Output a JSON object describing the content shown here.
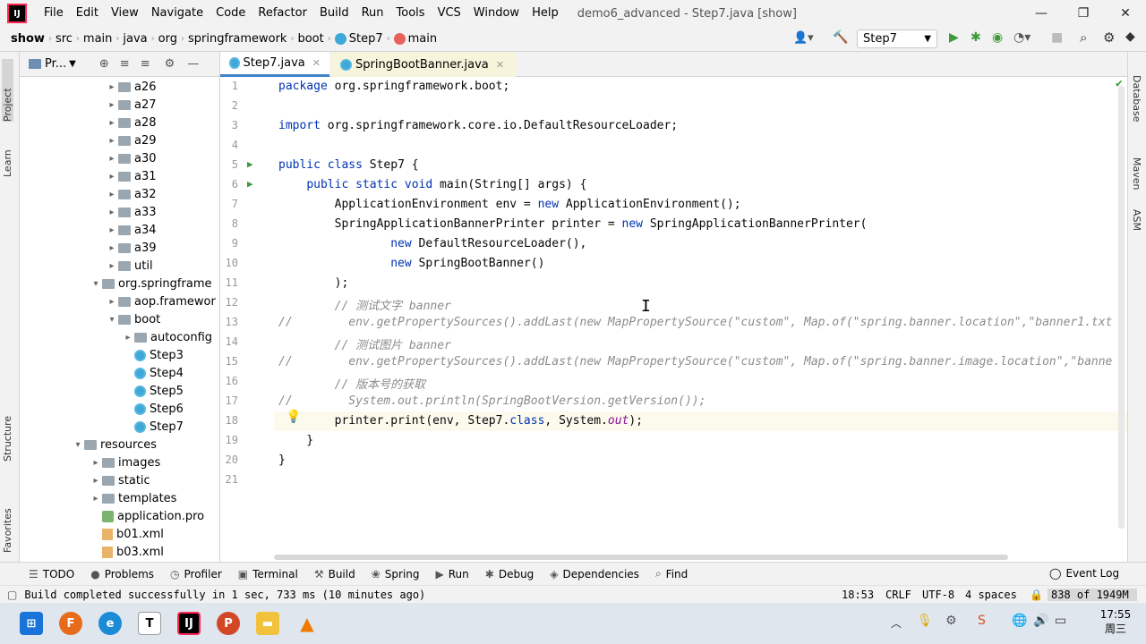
{
  "window": {
    "title": "demo6_advanced - Step7.java [show]"
  },
  "menu": [
    "File",
    "Edit",
    "View",
    "Navigate",
    "Code",
    "Refactor",
    "Build",
    "Run",
    "Tools",
    "VCS",
    "Window",
    "Help"
  ],
  "breadcrumb": [
    "show",
    "src",
    "main",
    "java",
    "org",
    "springframework",
    "boot",
    "Step7",
    "main"
  ],
  "run_config": "Step7",
  "project_panel": {
    "title": "Pr...",
    "tree": [
      {
        "label": "a26",
        "type": "folder",
        "level": 1
      },
      {
        "label": "a27",
        "type": "folder",
        "level": 1
      },
      {
        "label": "a28",
        "type": "folder",
        "level": 1
      },
      {
        "label": "a29",
        "type": "folder",
        "level": 1
      },
      {
        "label": "a30",
        "type": "folder",
        "level": 1
      },
      {
        "label": "a31",
        "type": "folder",
        "level": 1
      },
      {
        "label": "a32",
        "type": "folder",
        "level": 1
      },
      {
        "label": "a33",
        "type": "folder",
        "level": 1
      },
      {
        "label": "a34",
        "type": "folder",
        "level": 1
      },
      {
        "label": "a39",
        "type": "folder",
        "level": 1
      },
      {
        "label": "util",
        "type": "folder",
        "level": 1
      },
      {
        "label": "org.springframe",
        "type": "folder",
        "level": 0
      },
      {
        "label": "aop.framewor",
        "type": "folder",
        "level": 1
      },
      {
        "label": "boot",
        "type": "folder",
        "level": 1
      },
      {
        "label": "autoconfig",
        "type": "folder",
        "level": 2
      },
      {
        "label": "Step3",
        "type": "class",
        "level": 2
      },
      {
        "label": "Step4",
        "type": "class",
        "level": 2
      },
      {
        "label": "Step5",
        "type": "class",
        "level": 2
      },
      {
        "label": "Step6",
        "type": "class",
        "level": 2
      },
      {
        "label": "Step7",
        "type": "class",
        "level": 2
      },
      {
        "label": "resources",
        "type": "folder",
        "level": -1
      },
      {
        "label": "images",
        "type": "folder",
        "level": 0
      },
      {
        "label": "static",
        "type": "folder",
        "level": 0
      },
      {
        "label": "templates",
        "type": "folder",
        "level": 0
      },
      {
        "label": "application.pro",
        "type": "props",
        "level": 0
      },
      {
        "label": "b01.xml",
        "type": "xml",
        "level": 0
      },
      {
        "label": "b03.xml",
        "type": "xml",
        "level": 0
      }
    ]
  },
  "tabs": [
    {
      "label": "Step7.java",
      "active": true
    },
    {
      "label": "SpringBootBanner.java",
      "active": false
    }
  ],
  "code_lines": [
    {
      "n": "1",
      "t": "package org.springframework.boot;"
    },
    {
      "n": "2",
      "t": ""
    },
    {
      "n": "3",
      "t": "import org.springframework.core.io.DefaultResourceLoader;"
    },
    {
      "n": "4",
      "t": ""
    },
    {
      "n": "5",
      "t": "public class Step7 {"
    },
    {
      "n": "6",
      "t": "    public static void main(String[] args) {"
    },
    {
      "n": "7",
      "t": "        ApplicationEnvironment env = new ApplicationEnvironment();"
    },
    {
      "n": "8",
      "t": "        SpringApplicationBannerPrinter printer = new SpringApplicationBannerPrinter("
    },
    {
      "n": "9",
      "t": "                new DefaultResourceLoader(),"
    },
    {
      "n": "10",
      "t": "                new SpringBootBanner()"
    },
    {
      "n": "11",
      "t": "        );"
    },
    {
      "n": "12",
      "t": "        // 测试文字 banner"
    },
    {
      "n": "13",
      "t": "//        env.getPropertySources().addLast(new MapPropertySource(\"custom\", Map.of(\"spring.banner.location\",\"banner1.txt"
    },
    {
      "n": "14",
      "t": "        // 测试图片 banner"
    },
    {
      "n": "15",
      "t": "//        env.getPropertySources().addLast(new MapPropertySource(\"custom\", Map.of(\"spring.banner.image.location\",\"banne"
    },
    {
      "n": "16",
      "t": "        // 版本号的获取"
    },
    {
      "n": "17",
      "t": "//        System.out.println(SpringBootVersion.getVersion());"
    },
    {
      "n": "18",
      "t": "        printer.print(env, Step7.class, System.out);"
    },
    {
      "n": "19",
      "t": "    }"
    },
    {
      "n": "20",
      "t": "}"
    },
    {
      "n": "21",
      "t": ""
    }
  ],
  "bottom_tools": [
    "TODO",
    "Problems",
    "Profiler",
    "Terminal",
    "Build",
    "Spring",
    "Run",
    "Debug",
    "Dependencies",
    "Find"
  ],
  "event_log": "Event Log",
  "status": {
    "message": "Build completed successfully in 1 sec, 733 ms (10 minutes ago)",
    "position": "18:53",
    "line_sep": "CRLF",
    "encoding": "UTF-8",
    "indent": "4 spaces",
    "memory": "838 of 1949M"
  },
  "side_tabs_left": [
    "Project",
    "Learn",
    "Structure",
    "Favorites"
  ],
  "side_tabs_right": [
    "Database",
    "Maven",
    "ASM"
  ],
  "taskbar": {
    "time": "17:55",
    "date": "周三"
  },
  "colors": {
    "accent": "#4083c9",
    "keyword": "#0033b3",
    "comment": "#8c8c8c"
  }
}
